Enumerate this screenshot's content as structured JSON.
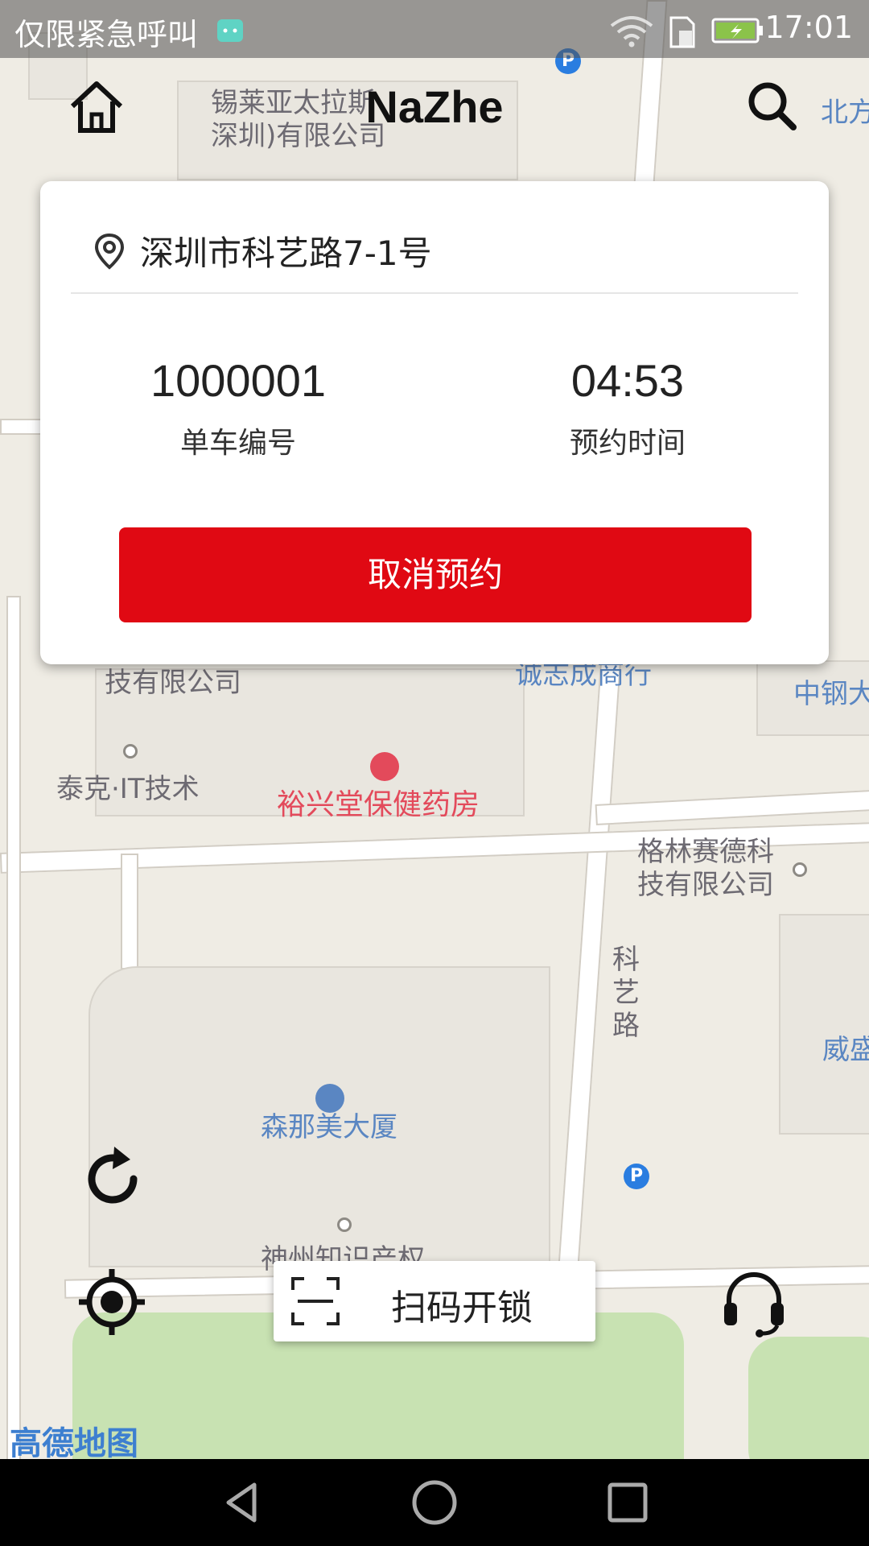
{
  "status_bar": {
    "carrier_text": "仅限紧急呼叫",
    "time": "17:01",
    "icons": [
      "android-icon",
      "wifi-icon",
      "sim-icon",
      "battery-icon"
    ]
  },
  "top_bar": {
    "title": "NaZhe",
    "left_icon": "home-icon",
    "right_icon": "search-icon"
  },
  "reservation_card": {
    "address": "深圳市科艺路7-1号",
    "bike_number": "1000001",
    "bike_number_label": "单车编号",
    "reserve_time": "04:53",
    "reserve_time_label": "预约时间",
    "cancel_label": "取消预约"
  },
  "map": {
    "labels": {
      "top_company": "锡莱亚太拉斯\n深圳)有限公司",
      "north_edge": "北方",
      "tech_company": "技有限公司",
      "chengzhicheng": "诚志成商行",
      "zhonggang": "中钢大",
      "taike": "泰克·IT技术",
      "pharmacy": "裕兴堂保健药房",
      "gelin": "格林赛德科\n技有限公司",
      "road_keyi": "科艺路",
      "senamei": "森那美大厦",
      "weisheng": "威盛",
      "shenzhou": "神州知识产权",
      "amap_logo": "高德地图"
    }
  },
  "controls": {
    "scan_label": "扫码开锁",
    "refresh_icon": "refresh-icon",
    "locate_icon": "locate-icon",
    "support_icon": "headset-icon",
    "scan_icon": "scan-frame-icon"
  },
  "nav_bar": {
    "buttons": [
      "back-icon",
      "home-circle-icon",
      "recents-icon"
    ]
  },
  "colors": {
    "accent_red": "#e00913",
    "map_background": "#efece4"
  }
}
